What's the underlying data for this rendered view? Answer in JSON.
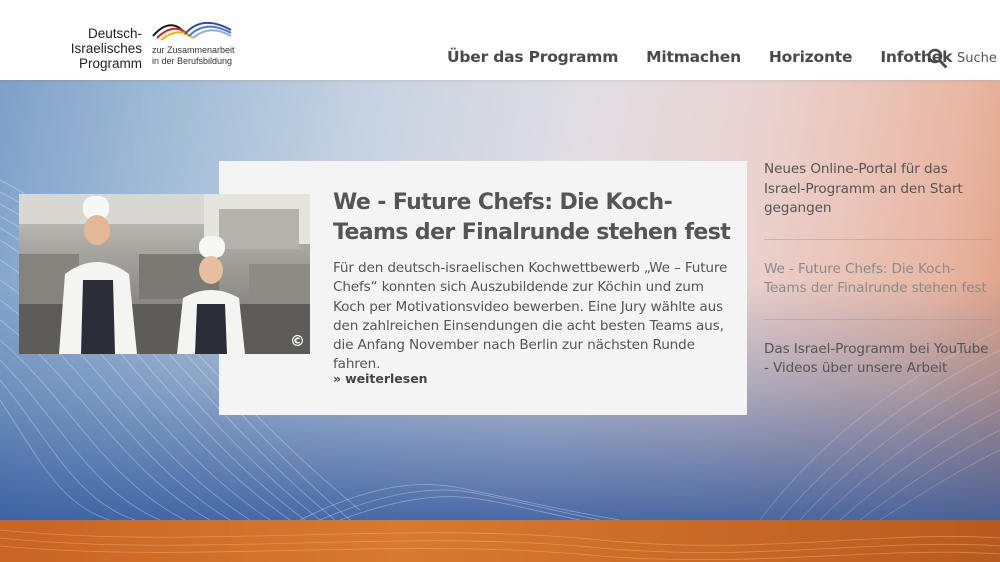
{
  "logo": {
    "main": "Deutsch-Israelisches Programm",
    "sub_line1": "zur Zusammenarbeit",
    "sub_line2": "in der Berufsbildung"
  },
  "nav": {
    "items": [
      {
        "label": "Über das Programm"
      },
      {
        "label": "Mitmachen"
      },
      {
        "label": "Horizonte"
      },
      {
        "label": "Infothek"
      }
    ]
  },
  "search": {
    "label": "Suche"
  },
  "featured": {
    "title": "We - Future Chefs: Die Koch-Teams der Finalrunde stehen fest",
    "text": "Für den deutsch-israelischen Kochwettbewerb „We – Future Chefs“ konnten sich Auszubildende zur Köchin und zum Koch per Motivationsvideo bewerben. Eine Jury wählte aus den zahlreichen Einsendungen die acht besten Teams aus, die Anfang November nach Berlin zur nächsten Runde fahren.",
    "more_arrow": "»",
    "more_label": "weiterlesen",
    "copyright": "©"
  },
  "side_news": {
    "items": [
      {
        "label": "Neues Online-Portal für das Israel-Programm an den Start gegangen"
      },
      {
        "label": "We - Future Chefs: Die Koch-Teams der Finalrunde stehen fest"
      },
      {
        "label": "Das Israel-Programm bei YouTube - Videos über unsere Arbeit"
      }
    ]
  },
  "colors": {
    "accent_orange": "#c86424",
    "hero_blue": "#30569b",
    "text_gray": "#555555"
  }
}
